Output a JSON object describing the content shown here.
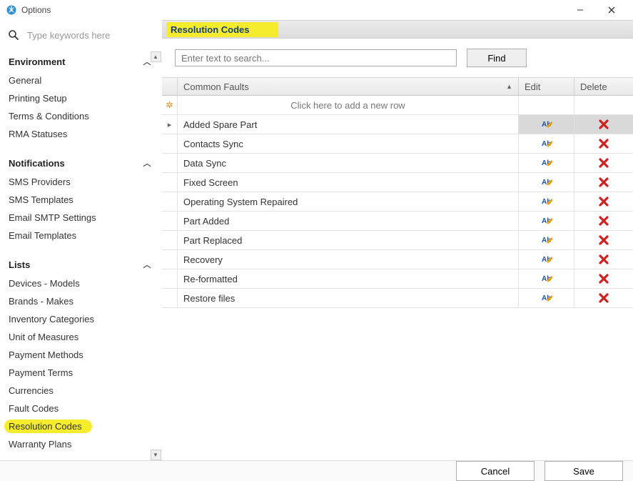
{
  "window": {
    "title": "Options"
  },
  "search": {
    "placeholder": "Type keywords here"
  },
  "sidebar": {
    "sections": [
      {
        "title": "Environment",
        "items": [
          {
            "label": "General"
          },
          {
            "label": "Printing Setup"
          },
          {
            "label": "Terms & Conditions"
          },
          {
            "label": "RMA Statuses"
          }
        ]
      },
      {
        "title": "Notifications",
        "items": [
          {
            "label": "SMS Providers"
          },
          {
            "label": "SMS Templates"
          },
          {
            "label": "Email SMTP Settings"
          },
          {
            "label": "Email Templates"
          }
        ]
      },
      {
        "title": "Lists",
        "items": [
          {
            "label": "Devices - Models"
          },
          {
            "label": "Brands - Makes"
          },
          {
            "label": "Inventory Categories"
          },
          {
            "label": "Unit of Measures"
          },
          {
            "label": "Payment Methods"
          },
          {
            "label": "Payment Terms"
          },
          {
            "label": "Currencies"
          },
          {
            "label": "Fault Codes"
          },
          {
            "label": "Resolution Codes",
            "highlighted": true
          },
          {
            "label": "Warranty Plans"
          }
        ]
      }
    ]
  },
  "panel": {
    "title": "Resolution Codes",
    "search_placeholder": "Enter text to search...",
    "find_label": "Find",
    "columns": {
      "fault": "Common Faults",
      "edit": "Edit",
      "delete": "Delete"
    },
    "new_row_hint": "Click here to add a new row",
    "rows": [
      {
        "fault": "Added Spare Part",
        "selected": true
      },
      {
        "fault": "Contacts Sync"
      },
      {
        "fault": "Data Sync"
      },
      {
        "fault": "Fixed Screen"
      },
      {
        "fault": "Operating System Repaired"
      },
      {
        "fault": "Part Added"
      },
      {
        "fault": "Part Replaced"
      },
      {
        "fault": "Recovery"
      },
      {
        "fault": "Re-formatted"
      },
      {
        "fault": "Restore files"
      }
    ]
  },
  "footer": {
    "cancel": "Cancel",
    "save": "Save"
  }
}
